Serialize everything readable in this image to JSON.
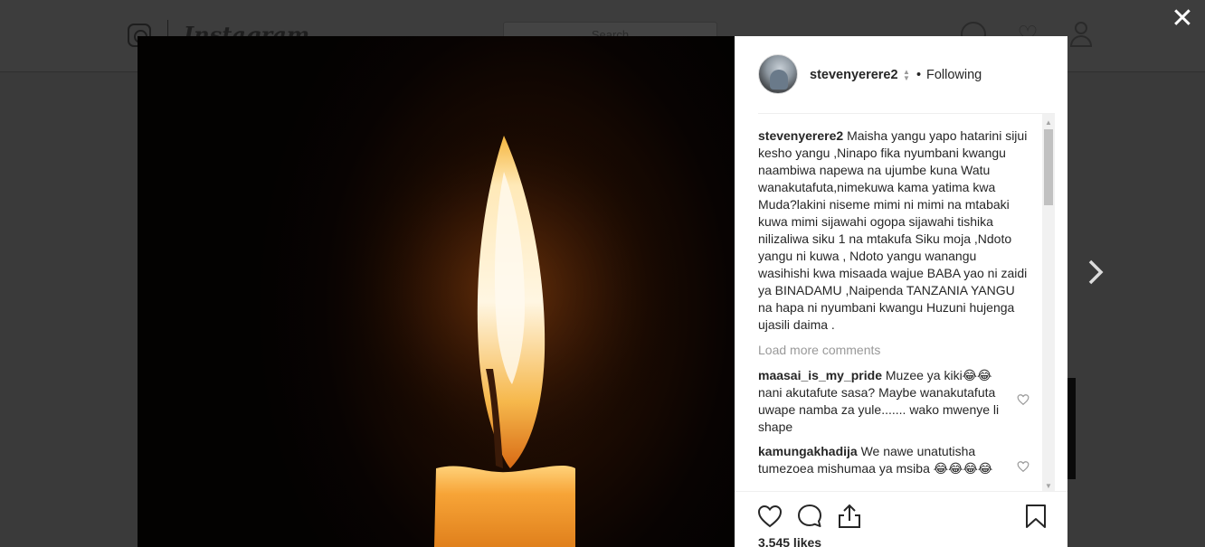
{
  "background": {
    "brand_name": "Instagram",
    "search_placeholder": "Search"
  },
  "post": {
    "username": "stevenyerere2",
    "follow_separator": "•",
    "follow_status": "Following",
    "caption_user": "stevenyerere2",
    "caption_text": "Maisha yangu yapo hatarini sijui kesho yangu ,Ninapo fika nyumbani kwangu naambiwa napewa na ujumbe kuna Watu wanakutafuta,nimekuwa kama yatima kwa Muda?lakini niseme mimi ni mimi na mtabaki kuwa mimi sijawahi ogopa sijawahi tishika nilizaliwa siku 1 na mtakufa Siku moja ,Ndoto yangu ni kuwa , Ndoto yangu wanangu wasihishi kwa misaada wajue BABA yao ni zaidi ya BINADAMU ,Naipenda TANZANIA YANGU na hapa ni nyumbani kwangu Huzuni hujenga ujasili daima .",
    "load_more": "Load more comments",
    "comments": [
      {
        "user": "maasai_is_my_pride",
        "text": "Muzee ya kiki😂😂nani akutafute sasa? Maybe wanakutafuta uwape namba za yule....... wako mwenye li shape"
      },
      {
        "user": "kamungakhadija",
        "text": "We nawe unatutisha tumezoea mishumaa ya msiba 😂😂😂😂"
      }
    ],
    "likes": "3,545 likes"
  },
  "icons": {
    "close": "close-icon",
    "next": "chevron-right-icon",
    "like": "heart-icon",
    "comment": "comment-bubble-icon",
    "share": "share-icon",
    "save": "bookmark-icon"
  },
  "colors": {
    "text": "#262626",
    "muted": "#999999",
    "overlay": "#3a3a3a"
  }
}
